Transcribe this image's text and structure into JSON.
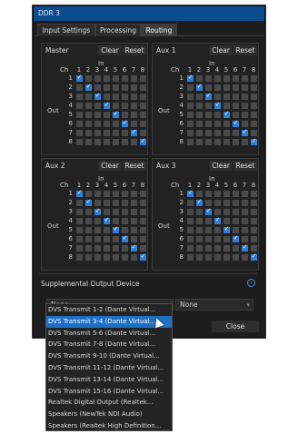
{
  "window": {
    "title": "DDR 3"
  },
  "tabs": [
    {
      "label": "Input Settings",
      "active": false
    },
    {
      "label": "Processing",
      "active": false
    },
    {
      "label": "Routing",
      "active": true
    }
  ],
  "matrix_labels": {
    "in": "In",
    "out": "Out",
    "ch": "Ch",
    "clear": "Clear",
    "reset": "Reset",
    "columns": [
      "1",
      "2",
      "3",
      "4",
      "5",
      "6",
      "7",
      "8"
    ],
    "rows": [
      "1",
      "2",
      "3",
      "4",
      "5",
      "6",
      "7",
      "8"
    ]
  },
  "panels": [
    {
      "name": "Master",
      "routing": [
        1,
        2,
        3,
        4,
        5,
        6,
        7,
        8
      ]
    },
    {
      "name": "Aux 1",
      "routing": [
        1,
        2,
        3,
        4,
        5,
        6,
        7,
        8
      ]
    },
    {
      "name": "Aux 2",
      "routing": [
        1,
        2,
        3,
        4,
        5,
        6,
        7,
        8
      ]
    },
    {
      "name": "Aux 3",
      "routing": [
        1,
        2,
        3,
        4,
        5,
        6,
        7,
        8
      ]
    }
  ],
  "supplemental": {
    "label": "Supplemental Output Device",
    "left_value": "None",
    "right_value": "None"
  },
  "dropdown_options": [
    "DVS Transmit  1-2 (Dante Virtual...",
    "DVS Transmit  3-4 (Dante Virtual...",
    "DVS Transmit  5-6 (Dante Virtual...",
    "DVS Transmit  7-8 (Dante Virtual...",
    "DVS Transmit  9-10 (Dante Virtual...",
    "DVS Transmit 11-12 (Dante Virtual...",
    "DVS Transmit 13-14 (Dante Virtual...",
    "DVS Transmit 15-16 (Dante Virtual...",
    "Realtek Digital Output (Realtek...",
    "Speakers (NewTek NDI Audio)",
    "Speakers (Realtek High Definition..."
  ],
  "dropdown_selected_index": 1,
  "footer": {
    "close": "Close"
  },
  "colors": {
    "titlebar": "#0a4d8f",
    "accent": "#2d7fd7",
    "background": "#1d1d1d"
  }
}
